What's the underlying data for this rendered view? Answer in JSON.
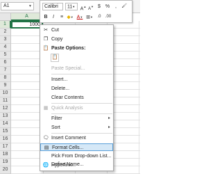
{
  "formula_bar": {
    "name_box": "A1"
  },
  "mini_toolbar": {
    "font_name": "Calibri",
    "font_size": "11",
    "bold": "B",
    "italic": "I",
    "font_color": "A",
    "grow_font": "A",
    "shrink_font": "A",
    "currency": "$",
    "percent": "%",
    "comma": ",",
    "decimal": ".0"
  },
  "grid": {
    "column_header": "A",
    "row_numbers": [
      "1",
      "2",
      "3",
      "4",
      "5",
      "6",
      "7",
      "8",
      "9",
      "10",
      "11",
      "12",
      "13",
      "14",
      "15",
      "16",
      "17",
      "18",
      "19",
      "20"
    ],
    "cell_a1_value": "1000"
  },
  "context_menu": {
    "cut": "Cut",
    "copy": "Copy",
    "paste_options": "Paste Options:",
    "paste_special": "Paste Special...",
    "insert": "Insert...",
    "delete": "Delete...",
    "clear_contents": "Clear Contents",
    "quick_analysis": "Quick Analysis",
    "filter": "Filter",
    "sort": "Sort",
    "insert_comment": "Insert Comment",
    "format_cells": "Format Cells...",
    "pick_from_list": "Pick From Drop-down List...",
    "define_name": "Define Name...",
    "hyperlink": "Hyperlink..."
  },
  "colors": {
    "accent": "#217346",
    "highlight_bg": "#d5e8f7",
    "highlight_border": "#5a9fd8"
  }
}
